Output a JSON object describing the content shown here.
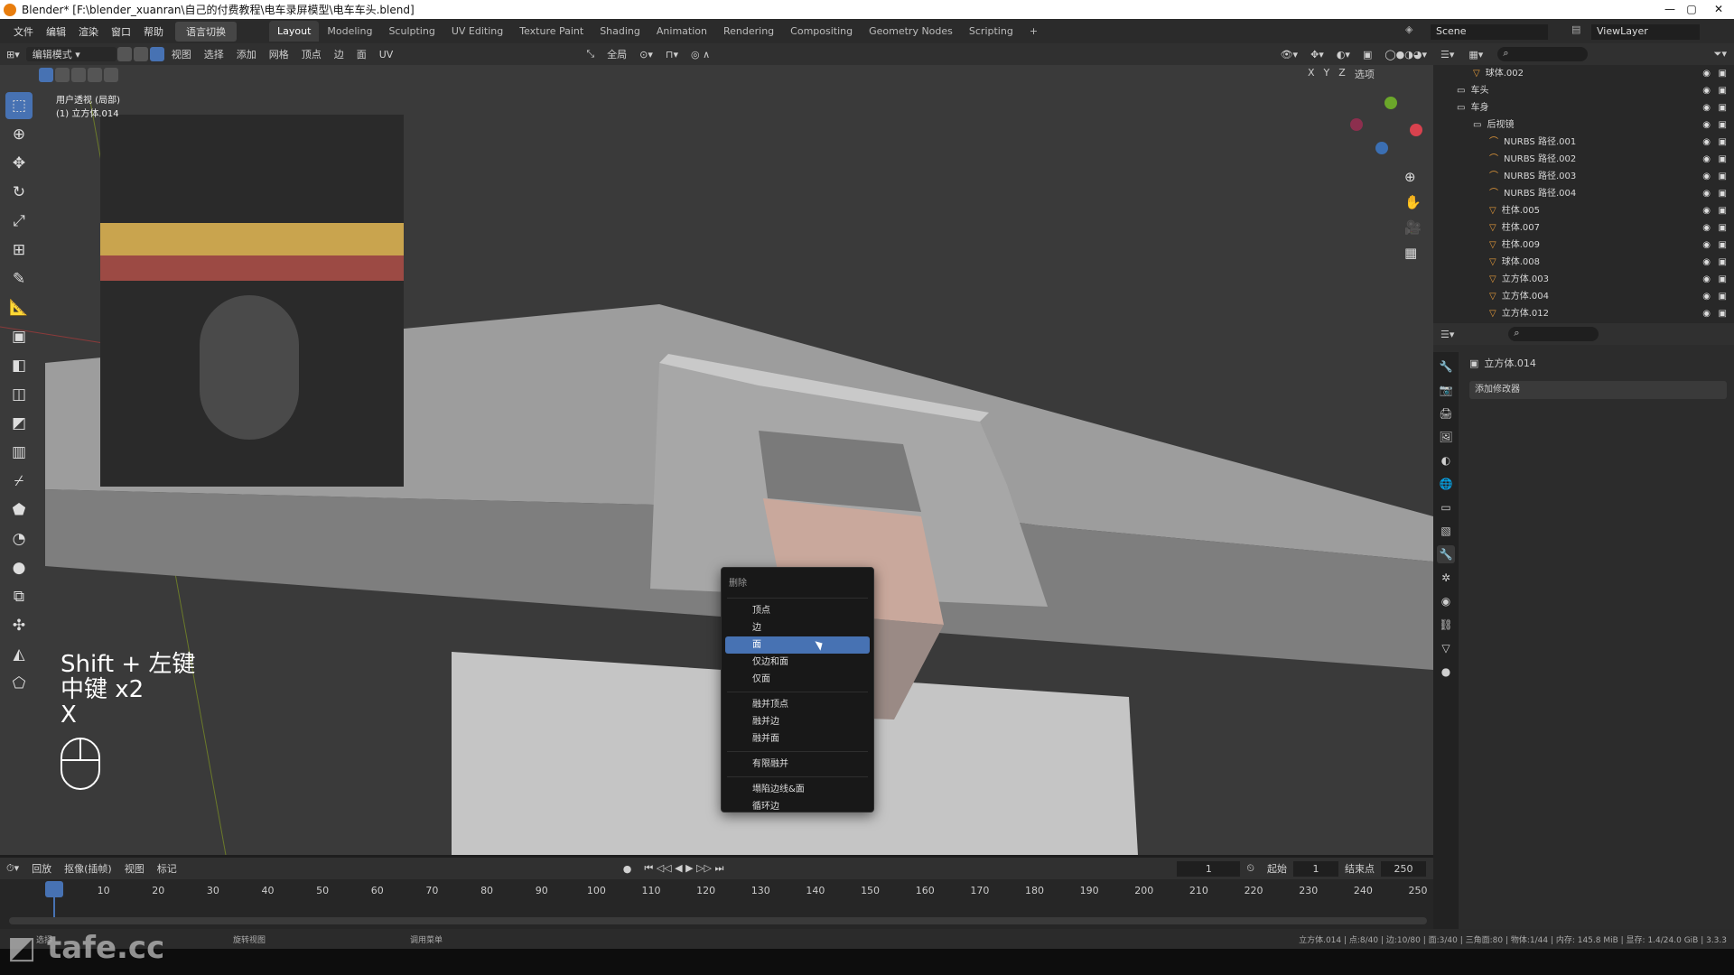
{
  "window": {
    "title": "Blender* [F:\\blender_xuanran\\自己的付费教程\\电车录屏模型\\电车车头.blend]"
  },
  "menus": [
    "文件",
    "编辑",
    "渲染",
    "窗口",
    "帮助"
  ],
  "lang_button": "语言切换",
  "workspaces": [
    "Layout",
    "Modeling",
    "Sculpting",
    "UV Editing",
    "Texture Paint",
    "Shading",
    "Animation",
    "Rendering",
    "Compositing",
    "Geometry Nodes",
    "Scripting",
    "+"
  ],
  "scene": "Scene",
  "view_layer": "ViewLayer",
  "viewport_header": {
    "mode": "编辑模式",
    "menus": [
      "视图",
      "选择",
      "添加",
      "网格",
      "顶点",
      "边",
      "面",
      "UV"
    ],
    "transform_orientation": "全局",
    "axes": [
      "X",
      "Y",
      "Z"
    ],
    "options": "选项"
  },
  "viewport_overlay": {
    "view_name": "用户透视 (局部)",
    "object_name": "(1) 立方体.014"
  },
  "key_hints": [
    "Shift + 左键",
    "中键 x2",
    "X"
  ],
  "context_menu": {
    "title": "删除",
    "groups": [
      [
        "顶点",
        "边",
        "面",
        "仅边和面",
        "仅面"
      ],
      [
        "融并顶点",
        "融并边",
        "融并面"
      ],
      [
        "有限融并"
      ],
      [
        "塌陷边线&面",
        "循环边"
      ]
    ],
    "highlighted": "面"
  },
  "outliner": {
    "rows": [
      {
        "name": "球体.002",
        "indent": 2,
        "type": "mesh"
      },
      {
        "name": "车头",
        "indent": 1,
        "type": "collection"
      },
      {
        "name": "车身",
        "indent": 1,
        "type": "collection"
      },
      {
        "name": "后视镜",
        "indent": 2,
        "type": "collection"
      },
      {
        "name": "NURBS 路径.001",
        "indent": 3,
        "type": "curve"
      },
      {
        "name": "NURBS 路径.002",
        "indent": 3,
        "type": "curve"
      },
      {
        "name": "NURBS 路径.003",
        "indent": 3,
        "type": "curve"
      },
      {
        "name": "NURBS 路径.004",
        "indent": 3,
        "type": "curve"
      },
      {
        "name": "柱体.005",
        "indent": 3,
        "type": "mesh"
      },
      {
        "name": "柱体.007",
        "indent": 3,
        "type": "mesh"
      },
      {
        "name": "柱体.009",
        "indent": 3,
        "type": "mesh"
      },
      {
        "name": "球体.008",
        "indent": 3,
        "type": "mesh"
      },
      {
        "name": "立方体.003",
        "indent": 3,
        "type": "mesh"
      },
      {
        "name": "立方体.004",
        "indent": 3,
        "type": "mesh"
      },
      {
        "name": "立方体.012",
        "indent": 3,
        "type": "mesh"
      }
    ]
  },
  "properties": {
    "object_name": "立方体.014",
    "add_modifier": "添加修改器"
  },
  "timeline": {
    "menus": [
      "回放",
      "抠像(插帧)",
      "视图",
      "标记"
    ],
    "current_frame": "1",
    "start_label": "起始",
    "start": "1",
    "end_label": "结束点",
    "end": "250",
    "ticks": [
      "1",
      "10",
      "20",
      "30",
      "40",
      "50",
      "60",
      "70",
      "80",
      "90",
      "100",
      "110",
      "120",
      "130",
      "140",
      "150",
      "160",
      "170",
      "180",
      "190",
      "200",
      "210",
      "220",
      "230",
      "240",
      "250"
    ]
  },
  "status": {
    "left": "选择",
    "mid1": "旋转视图",
    "mid2": "调用菜单",
    "right": "立方体.014 | 点:8/40 | 边:10/80 | 面:3/40 | 三角面:80 | 物体:1/44 | 内存: 145.8 MiB | 显存: 1.4/24.0 GiB | 3.3.3"
  },
  "watermark": "tafe.cc",
  "colors": {
    "accent": "#4772b3",
    "selected_face": "#c9a89c",
    "viewport_bg": "#3a3a3a"
  }
}
